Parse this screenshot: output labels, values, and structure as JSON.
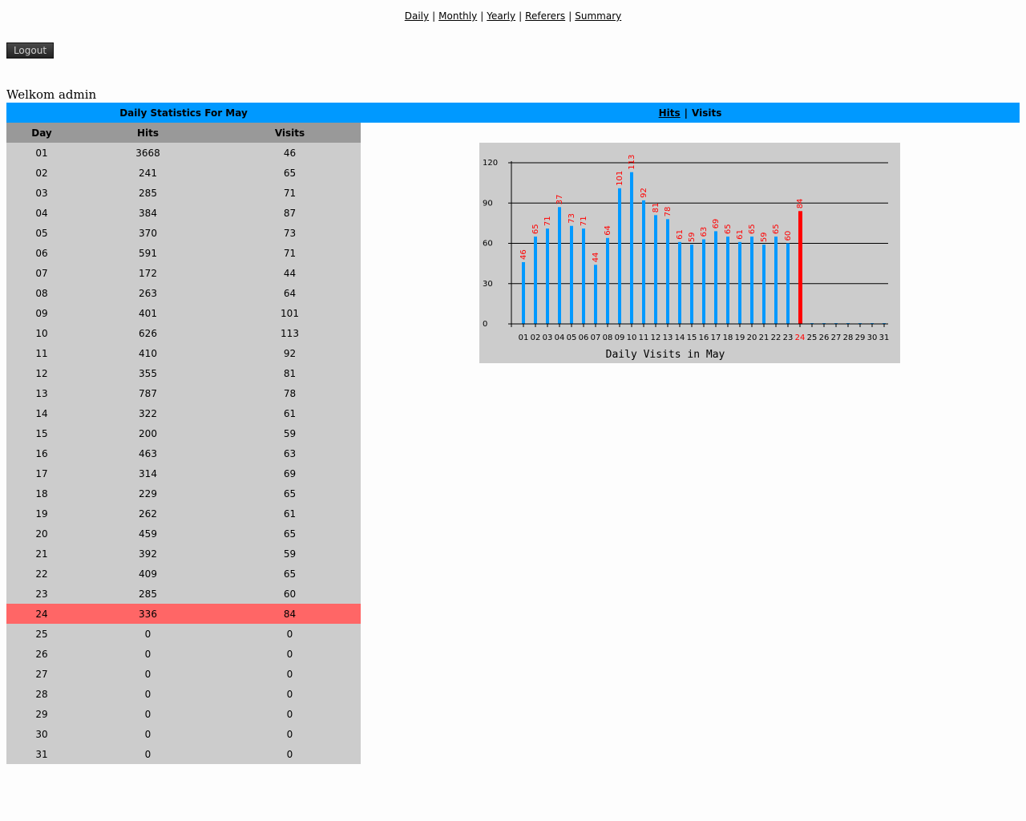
{
  "nav": {
    "links": [
      "Daily",
      "Monthly",
      "Yearly",
      "Referers",
      "Summary"
    ],
    "separator": "|"
  },
  "logout_label": "Logout",
  "welcome": "Welkom admin",
  "table_title": "Daily Statistics For May",
  "chart_toggle": {
    "hits": "Hits",
    "separator": "|",
    "visits": "Visits"
  },
  "headers": {
    "day": "Day",
    "hits": "Hits",
    "visits": "Visits"
  },
  "rows": [
    {
      "day": "01",
      "hits": "3668",
      "visits": "46"
    },
    {
      "day": "02",
      "hits": "241",
      "visits": "65"
    },
    {
      "day": "03",
      "hits": "285",
      "visits": "71"
    },
    {
      "day": "04",
      "hits": "384",
      "visits": "87"
    },
    {
      "day": "05",
      "hits": "370",
      "visits": "73"
    },
    {
      "day": "06",
      "hits": "591",
      "visits": "71"
    },
    {
      "day": "07",
      "hits": "172",
      "visits": "44"
    },
    {
      "day": "08",
      "hits": "263",
      "visits": "64"
    },
    {
      "day": "09",
      "hits": "401",
      "visits": "101"
    },
    {
      "day": "10",
      "hits": "626",
      "visits": "113"
    },
    {
      "day": "11",
      "hits": "410",
      "visits": "92"
    },
    {
      "day": "12",
      "hits": "355",
      "visits": "81"
    },
    {
      "day": "13",
      "hits": "787",
      "visits": "78"
    },
    {
      "day": "14",
      "hits": "322",
      "visits": "61"
    },
    {
      "day": "15",
      "hits": "200",
      "visits": "59"
    },
    {
      "day": "16",
      "hits": "463",
      "visits": "63"
    },
    {
      "day": "17",
      "hits": "314",
      "visits": "69"
    },
    {
      "day": "18",
      "hits": "229",
      "visits": "65"
    },
    {
      "day": "19",
      "hits": "262",
      "visits": "61"
    },
    {
      "day": "20",
      "hits": "459",
      "visits": "65"
    },
    {
      "day": "21",
      "hits": "392",
      "visits": "59"
    },
    {
      "day": "22",
      "hits": "409",
      "visits": "65"
    },
    {
      "day": "23",
      "hits": "285",
      "visits": "60"
    },
    {
      "day": "24",
      "hits": "336",
      "visits": "84"
    },
    {
      "day": "25",
      "hits": "0",
      "visits": "0"
    },
    {
      "day": "26",
      "hits": "0",
      "visits": "0"
    },
    {
      "day": "27",
      "hits": "0",
      "visits": "0"
    },
    {
      "day": "28",
      "hits": "0",
      "visits": "0"
    },
    {
      "day": "29",
      "hits": "0",
      "visits": "0"
    },
    {
      "day": "30",
      "hits": "0",
      "visits": "0"
    },
    {
      "day": "31",
      "hits": "0",
      "visits": "0"
    }
  ],
  "highlight_day": "24",
  "colors": {
    "bar": "#0099ff",
    "highlight_bar": "#ff0000",
    "value_label": "#ff0000",
    "header_bar": "#0099ff",
    "highlight_row": "#ff6666"
  },
  "chart_data": {
    "type": "bar",
    "xlabel": "Daily Visits in May",
    "ylim": [
      0,
      120
    ],
    "yticks": [
      0,
      30,
      60,
      90,
      120
    ],
    "grid": true,
    "categories": [
      "01",
      "02",
      "03",
      "04",
      "05",
      "06",
      "07",
      "08",
      "09",
      "10",
      "11",
      "12",
      "13",
      "14",
      "15",
      "16",
      "17",
      "18",
      "19",
      "20",
      "21",
      "22",
      "23",
      "24",
      "25",
      "26",
      "27",
      "28",
      "29",
      "30",
      "31"
    ],
    "values": [
      46,
      65,
      71,
      87,
      73,
      71,
      44,
      64,
      101,
      113,
      92,
      81,
      78,
      61,
      59,
      63,
      69,
      65,
      61,
      65,
      59,
      65,
      60,
      84,
      0,
      0,
      0,
      0,
      0,
      0,
      0
    ],
    "value_labels_shown": [
      "46",
      "65",
      "71",
      "37",
      "73",
      "71",
      "44",
      "64",
      "101",
      "113",
      "92",
      "81",
      "78",
      "61",
      "59",
      "63",
      "69",
      "65",
      "61",
      "65",
      "59",
      "65",
      "60",
      "84",
      "",
      "",
      "",
      "",
      "",
      "",
      ""
    ],
    "highlight_category": "24"
  }
}
